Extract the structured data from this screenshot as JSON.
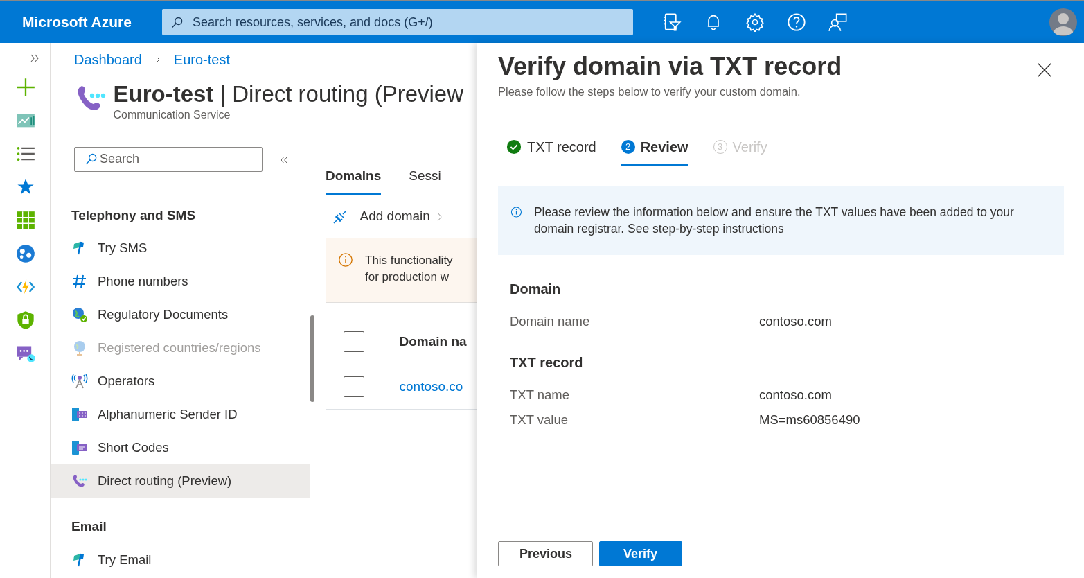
{
  "topbar": {
    "brand": "Microsoft Azure",
    "search": {
      "placeholder": "Search resources, services, and docs (G+/)"
    }
  },
  "breadcrumb": [
    "Dashboard",
    "Euro-test"
  ],
  "resource": {
    "name": "Euro-test",
    "separator": "|",
    "page": "Direct routing (Preview",
    "subtitle": "Communication Service"
  },
  "menu": {
    "search": {
      "placeholder": "Search"
    },
    "sections": [
      {
        "heading": "Telephony and SMS",
        "items": [
          {
            "label": "Try SMS",
            "kind": "flag",
            "disabled": false,
            "selected": false
          },
          {
            "label": "Phone numbers",
            "kind": "hash",
            "disabled": false,
            "selected": false
          },
          {
            "label": "Regulatory Documents",
            "kind": "globe-check",
            "disabled": false,
            "selected": false
          },
          {
            "label": "Registered countries/regions",
            "kind": "globe",
            "disabled": true,
            "selected": false
          },
          {
            "label": "Operators",
            "kind": "tower",
            "disabled": false,
            "selected": false
          },
          {
            "label": "Alphanumeric Sender ID",
            "kind": "phone-msg",
            "disabled": false,
            "selected": false
          },
          {
            "label": "Short Codes",
            "kind": "phone-chat",
            "disabled": false,
            "selected": false
          },
          {
            "label": "Direct routing (Preview)",
            "kind": "call",
            "disabled": false,
            "selected": true
          }
        ]
      },
      {
        "heading": "Email",
        "items": [
          {
            "label": "Try Email",
            "kind": "flag",
            "disabled": false,
            "selected": false
          }
        ]
      }
    ]
  },
  "content": {
    "tabs": [
      {
        "label": "Domains",
        "selected": true
      },
      {
        "label": "Sessi",
        "selected": false
      }
    ],
    "toolbar": {
      "add": "Add domain"
    },
    "banner": {
      "lines": [
        "This functionality",
        "for production w"
      ]
    },
    "table": {
      "header": "Domain na",
      "rows": [
        {
          "domain": "contoso.co",
          "checked": false
        }
      ],
      "header_checked": false
    }
  },
  "panel": {
    "title": "Verify domain via TXT record",
    "subtitle": "Please follow the steps below to verify your custom domain.",
    "steps": [
      {
        "label": "TXT record",
        "kind": "done",
        "selected": false
      },
      {
        "label": "Review",
        "kind": "current",
        "number": "2",
        "selected": true
      },
      {
        "label": "Verify",
        "kind": "pending",
        "number": "3",
        "selected": false
      }
    ],
    "info": "Please review the information below and ensure the TXT values have been added to your domain registrar. See step-by-step instructions",
    "sections": [
      {
        "heading": "Domain",
        "fields": [
          {
            "label": "Domain name",
            "value": "contoso.com"
          }
        ]
      },
      {
        "heading": "TXT record",
        "fields": [
          {
            "label": "TXT name",
            "value": "contoso.com"
          },
          {
            "label": "TXT value",
            "value": "MS=ms60856490"
          }
        ]
      }
    ],
    "buttons": [
      {
        "label": "Previous",
        "kind": "secondary"
      },
      {
        "label": "Verify",
        "kind": "primary"
      }
    ]
  }
}
